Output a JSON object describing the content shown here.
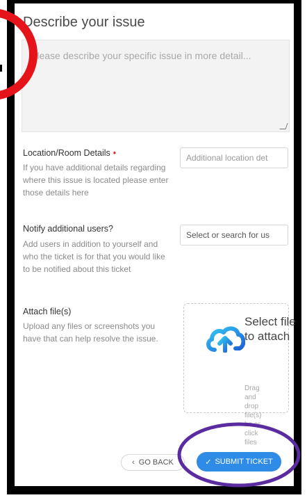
{
  "form": {
    "title": "Describe your issue",
    "description_placeholder": "Please describe your specific issue in more detail...",
    "location": {
      "label": "Location/Room Details",
      "required_mark": "•",
      "help": "If you have additional details regarding where this issue is located please enter those details here",
      "placeholder": "Additional location det"
    },
    "notify": {
      "label": "Notify additional users?",
      "help": "Add users in addition to yourself and who the ticket is for that you would like to be notified about this ticket",
      "placeholder": "Select or search for us"
    },
    "attach": {
      "label": "Attach file(s)",
      "help": "Upload any files or screenshots you have that can help resolve the issue.",
      "select_text": "Select file to attach",
      "drag_text": "Drag and drop file(s) he or click files"
    }
  },
  "actions": {
    "back_label": "GO BACK",
    "submit_label": "SUBMIT TICKET"
  },
  "colors": {
    "accent": "#2e8ce6",
    "required": "#e0232a",
    "red_annotation": "#e5141b",
    "purple_annotation": "#5a2ca0"
  },
  "icons": {
    "upload": "cloud-upload-icon",
    "back": "chevron-left-icon",
    "submit": "check-icon"
  }
}
